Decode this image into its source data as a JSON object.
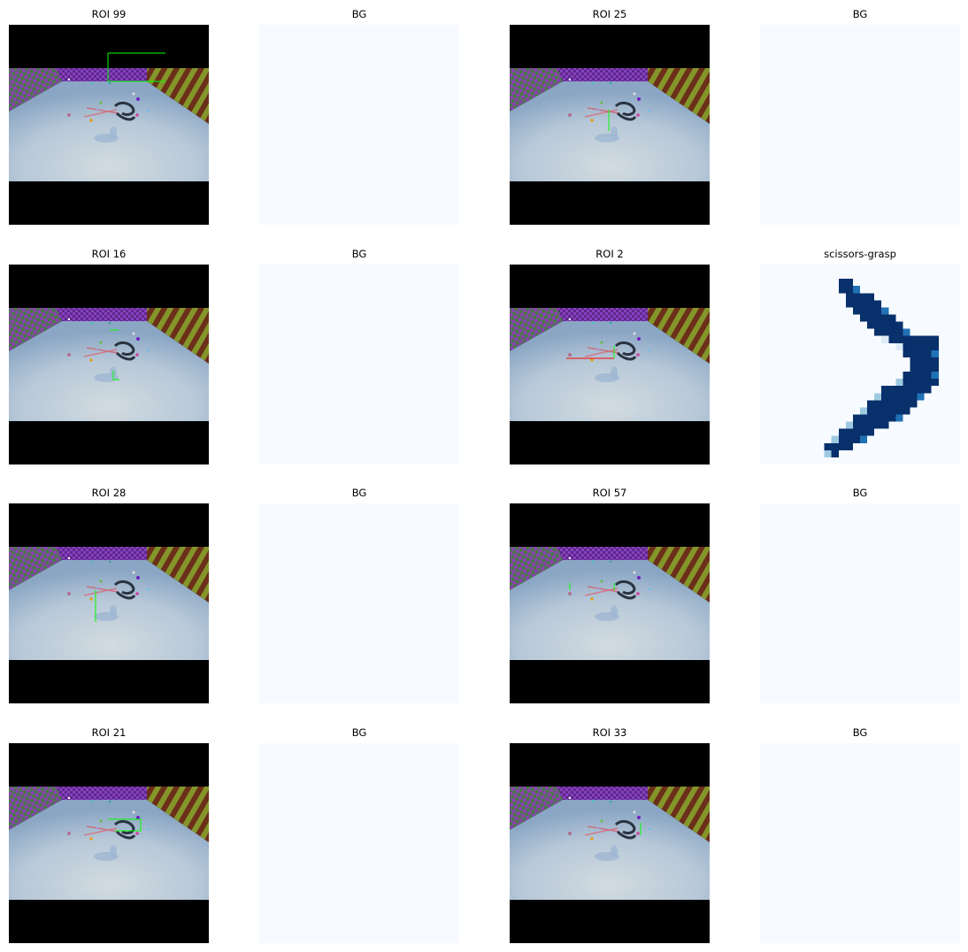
{
  "colors": {
    "background": "#ffffff",
    "mask_background": "#f7fbff",
    "mask_dark": "#08306b",
    "mask_mid": "#2171b5",
    "mask_light": "#9ecae1",
    "mask_pale": "#deebf7",
    "box_positive": "#00ff00",
    "box_class": "#ff0000",
    "floor_light": "#cfd8de",
    "floor_blue": "#8eaac6",
    "wall_purple": "#7b2fa8",
    "wall_olive": "#7d8f25",
    "wall_brown": "#6b2f1a",
    "wall_green": "#4a8a4a"
  },
  "panels": [
    {
      "title": "ROI 99",
      "type": "image"
    },
    {
      "title": "BG",
      "type": "mask"
    },
    {
      "title": "ROI 25",
      "type": "image"
    },
    {
      "title": "BG",
      "type": "mask"
    },
    {
      "title": "ROI 16",
      "type": "image"
    },
    {
      "title": "BG",
      "type": "mask"
    },
    {
      "title": "ROI 2",
      "type": "image"
    },
    {
      "title": "scissors-grasp",
      "type": "mask"
    },
    {
      "title": "ROI 28",
      "type": "image"
    },
    {
      "title": "BG",
      "type": "mask"
    },
    {
      "title": "ROI 57",
      "type": "image"
    },
    {
      "title": "BG",
      "type": "mask"
    },
    {
      "title": "ROI 21",
      "type": "image"
    },
    {
      "title": "BG",
      "type": "mask"
    },
    {
      "title": "ROI 33",
      "type": "image"
    },
    {
      "title": "BG",
      "type": "mask"
    }
  ],
  "icons": {
    "scene": "rendered-scene-image",
    "mask": "mask-heatmap"
  }
}
